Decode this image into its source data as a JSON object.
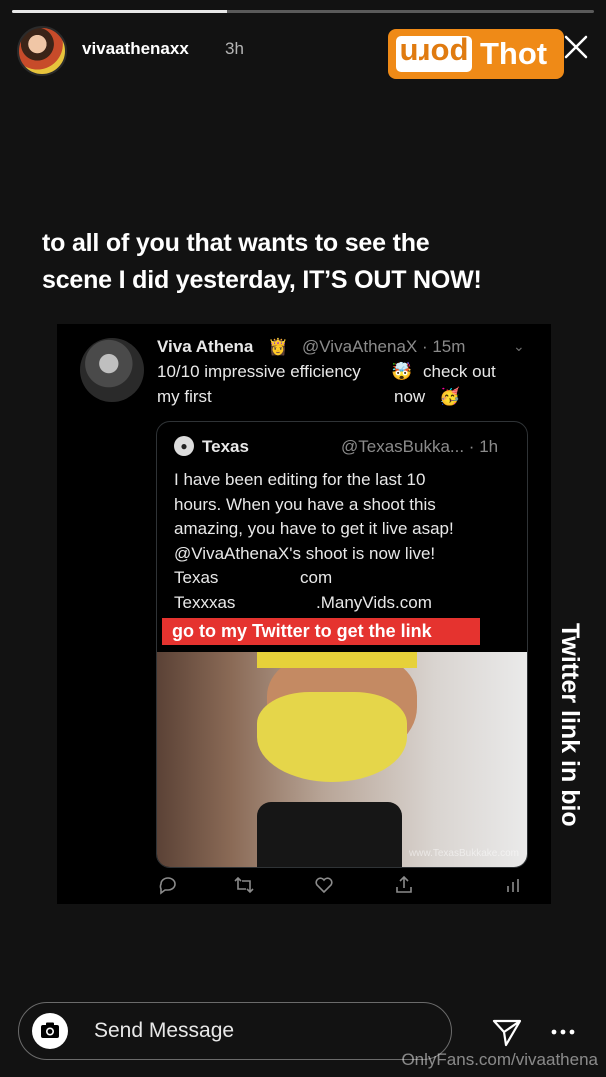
{
  "story": {
    "progress": 0.37,
    "username": "vivaathenaxx",
    "time": "3h"
  },
  "logo": {
    "left": "porn",
    "right": "Thot"
  },
  "caption": {
    "line1": "to all of you that wants to see the",
    "line2": "scene I did yesterday, IT’S OUT NOW!"
  },
  "tweet": {
    "name": "Viva Athena",
    "crown_emoji": "👸",
    "handle": "@VivaAthenaX · 15m",
    "text1": "10/10 impressive efficiency",
    "emoji1": "🤯",
    "text2": "check out",
    "text3": "my first",
    "text4": "now",
    "emoji2": "🥳",
    "quote": {
      "name": "Texas",
      "handle": "@TexasBukka... · 1h",
      "lines": [
        "I have been editing for the last 10",
        "hours. When you have a shoot this",
        "amazing, you have to get it live asap!",
        "@VivaAthenaX's shoot is now live!"
      ],
      "link1_a": "Texas",
      "link1_b": "com",
      "link2_a": "Texxxas",
      "link2_b": ".ManyVids.com",
      "banner": "go to my Twitter to get the link",
      "photo_watermark": "www.TexasBukkake.com"
    }
  },
  "side_text": "Twitter link in bio",
  "message_bar": {
    "placeholder": "Send Message"
  },
  "watermark": "OnlyFans.com/vivaathena",
  "icons": {
    "camera": "camera-icon",
    "send": "send-icon",
    "more": "more-icon",
    "close": "close-icon"
  },
  "colors": {
    "banner": "#e5332f",
    "logo": "#ef8a17"
  }
}
